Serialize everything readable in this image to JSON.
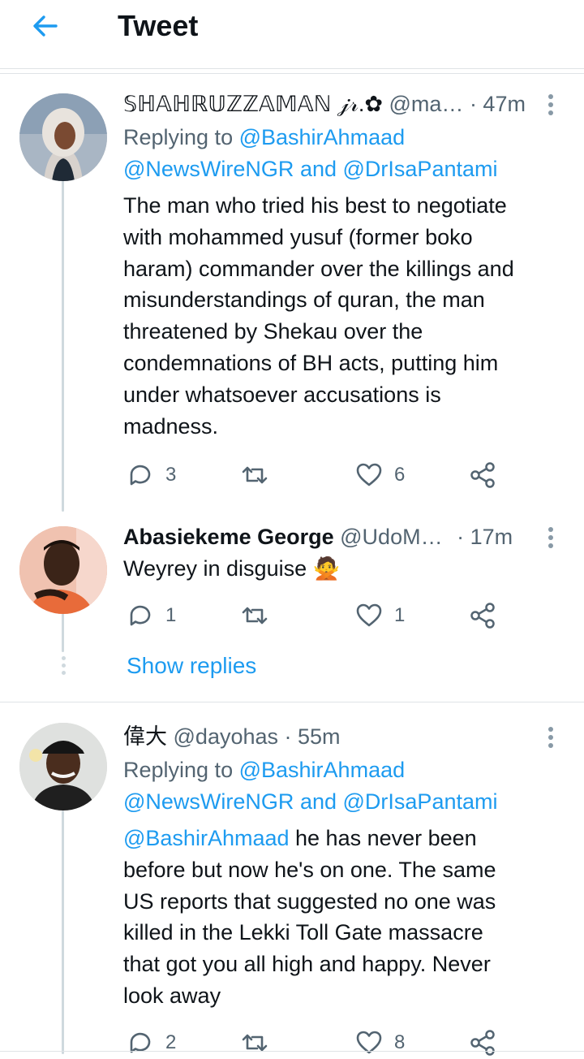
{
  "header": {
    "title": "Tweet",
    "back_icon": "arrow-left-icon"
  },
  "tweets": [
    {
      "name": "𝕊ℍ𝔸ℍℝ𝕌ℤℤ𝔸𝕄𝔸ℕ 𝒿𝓇.✿",
      "handle": "@ma…",
      "time": "· 47m",
      "replying_prefix": "Replying to",
      "replying_1": "@BashirAhmaad",
      "replying_2": "@NewsWireNGR",
      "replying_and": "and",
      "replying_3": "@DrIsaPantami",
      "body_lines": [
        "The man who tried his best to negotiate",
        "with mohammed yusuf (former boko",
        "haram) commander over the killings and",
        "misunderstandings of quran, the man",
        "threatened by Shekau over the",
        "condemnations of BH acts, putting him",
        "under whatsoever accusations is",
        "madness."
      ],
      "replies": "3",
      "retweets": "",
      "likes": "6"
    },
    {
      "name": "Abasiekeme George",
      "handle": "@UdoM…",
      "time": "· 17m",
      "body_lines": [
        "Weyrey in disguise 🙅"
      ],
      "replies": "1",
      "retweets": "",
      "likes": "1"
    },
    {
      "name": "偉大",
      "handle": "@dayohas",
      "time": "· 55m",
      "replying_prefix": "Replying to",
      "replying_1": "@BashirAhmaad",
      "replying_2": "@NewsWireNGR",
      "replying_and": "and",
      "replying_3": "@DrIsaPantami",
      "mention": "@BashirAhmaad",
      "body_first_rest": " he has never been",
      "body_lines": [
        "before but now he's on one. The same",
        "US reports that suggested no one was",
        "killed in the Lekki Toll Gate massacre",
        "that got you all high and happy. Never",
        "look away"
      ],
      "replies": "2",
      "retweets": "",
      "likes": "8"
    }
  ],
  "show_replies": "Show replies",
  "colors": {
    "accent": "#1d9bf0",
    "muted": "#536471",
    "divider": "#dfe3e6"
  }
}
